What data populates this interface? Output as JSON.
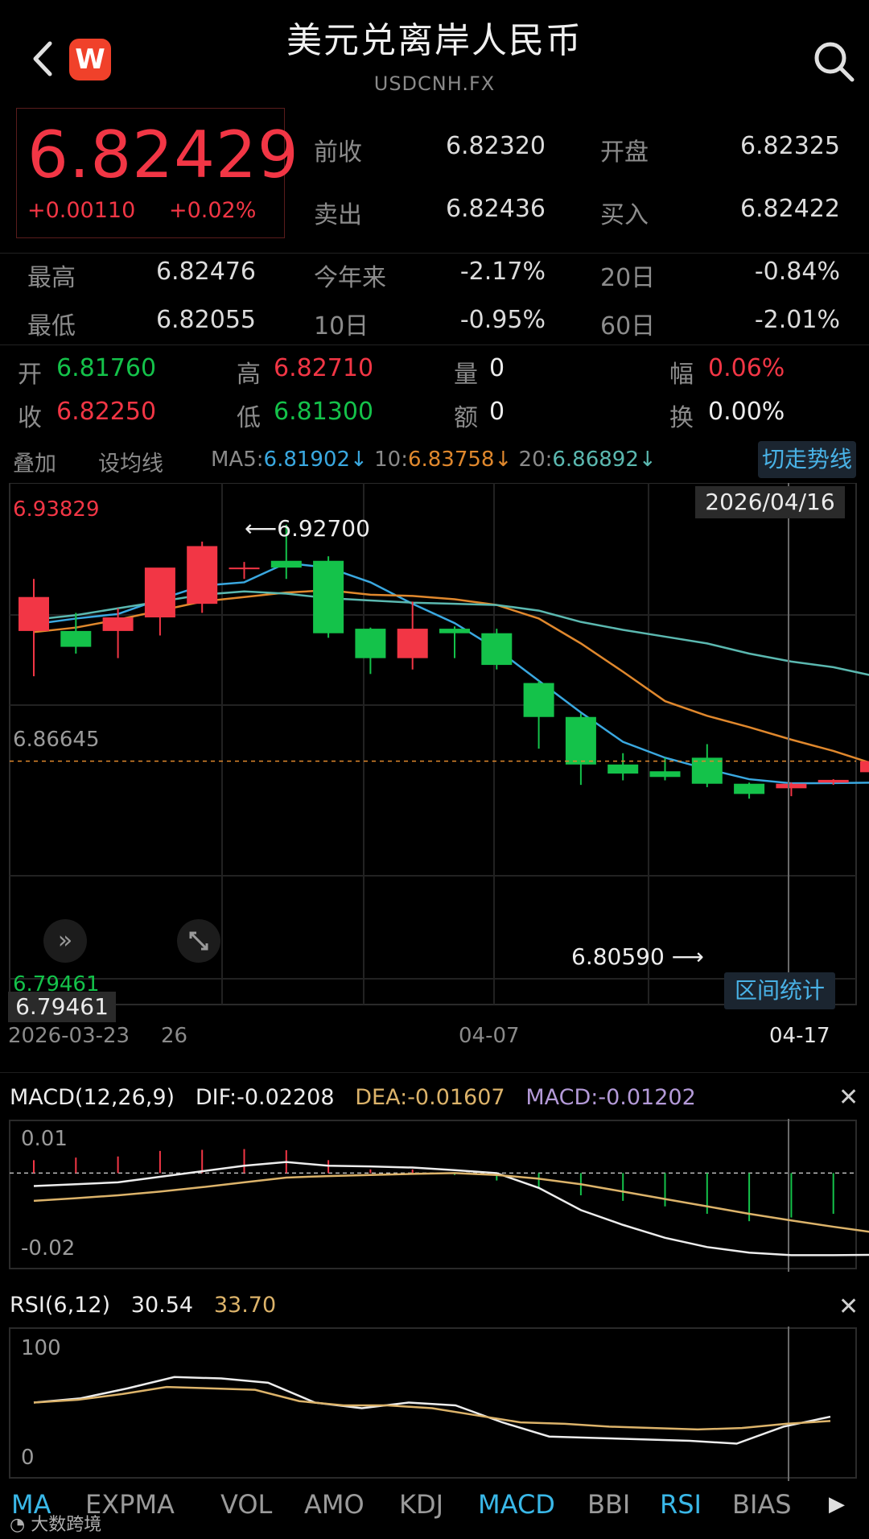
{
  "header": {
    "title": "美元兑离岸人民币",
    "symbol": "USDCNH.FX",
    "logo_letter": "W"
  },
  "quote": {
    "price": "6.82429",
    "change": "+0.00110",
    "change_pct": "+0.02%",
    "prev_close_label": "前收",
    "prev_close": "6.82320",
    "open_label": "开盘",
    "open": "6.82325",
    "ask_label": "卖出",
    "ask": "6.82436",
    "bid_label": "买入",
    "bid": "6.82422"
  },
  "stats": {
    "high_label": "最高",
    "high": "6.82476",
    "ytd_label": "今年来",
    "ytd": "-2.17%",
    "d20_label": "20日",
    "d20": "-0.84%",
    "low_label": "最低",
    "low": "6.82055",
    "d10_label": "10日",
    "d10": "-0.95%",
    "d60_label": "60日",
    "d60": "-2.01%"
  },
  "ohlc": {
    "open_label": "开",
    "open": "6.81760",
    "high_label": "高",
    "high": "6.82710",
    "vol_label": "量",
    "vol": "0",
    "amp_label": "幅",
    "amp": "0.06%",
    "close_label": "收",
    "close": "6.82250",
    "low_label": "低",
    "low": "6.81300",
    "amt_label": "额",
    "amt": "0",
    "turn_label": "换",
    "turn": "0.00%"
  },
  "toolbar": {
    "overlay": "叠加",
    "set_ma": "设均线",
    "ma5_label": "MA5:",
    "ma5": "6.81902↓",
    "ma10_label": "10:",
    "ma10": "6.83758↓",
    "ma20_label": "20:",
    "ma20": "6.86892↓",
    "switch_trend": "切走势线"
  },
  "main_chart": {
    "top_price": "6.93829",
    "mid_price": "6.86645",
    "bottom_price": "6.79461",
    "crosshair_price": "6.79461",
    "crosshair_date": "2026/04/16",
    "max_annot": "6.92700",
    "min_annot": "6.80590",
    "date_start": "2026-03-23",
    "date_26": "26",
    "date_mid": "04-07",
    "date_end": "04-17",
    "range_stats": "区间统计"
  },
  "chart_data": [
    {
      "type": "candlestick",
      "ylim": [
        6.79461,
        6.93829
      ],
      "candles": [
        {
          "o": 6.88,
          "h": 6.903,
          "l": 6.86,
          "c": 6.895
        },
        {
          "o": 6.88,
          "h": 6.888,
          "l": 6.87,
          "c": 6.873
        },
        {
          "o": 6.88,
          "h": 6.89,
          "l": 6.868,
          "c": 6.886
        },
        {
          "o": 6.886,
          "h": 6.905,
          "l": 6.878,
          "c": 6.908
        },
        {
          "o": 6.892,
          "h": 6.9195,
          "l": 6.888,
          "c": 6.9175
        },
        {
          "o": 6.908,
          "h": 6.9105,
          "l": 6.903,
          "c": 6.908
        },
        {
          "o": 6.911,
          "h": 6.927,
          "l": 6.903,
          "c": 6.908
        },
        {
          "o": 6.911,
          "h": 6.913,
          "l": 6.877,
          "c": 6.879
        },
        {
          "o": 6.881,
          "h": 6.8815,
          "l": 6.861,
          "c": 6.868
        },
        {
          "o": 6.868,
          "h": 6.893,
          "l": 6.863,
          "c": 6.881
        },
        {
          "o": 6.881,
          "h": 6.882,
          "l": 6.868,
          "c": 6.879
        },
        {
          "o": 6.879,
          "h": 6.881,
          "l": 6.863,
          "c": 6.865
        },
        {
          "o": 6.857,
          "h": 6.858,
          "l": 6.828,
          "c": 6.842
        },
        {
          "o": 6.842,
          "h": 6.8435,
          "l": 6.812,
          "c": 6.821
        },
        {
          "o": 6.821,
          "h": 6.826,
          "l": 6.814,
          "c": 6.817
        },
        {
          "o": 6.818,
          "h": 6.824,
          "l": 6.814,
          "c": 6.8155
        },
        {
          "o": 6.824,
          "h": 6.83,
          "l": 6.811,
          "c": 6.8125
        },
        {
          "o": 6.8125,
          "h": 6.813,
          "l": 6.8059,
          "c": 6.808
        },
        {
          "o": 6.8105,
          "h": 6.813,
          "l": 6.807,
          "c": 6.8125
        },
        {
          "o": 6.813,
          "h": 6.8145,
          "l": 6.812,
          "c": 6.8142
        },
        {
          "o": 6.8176,
          "h": 6.8271,
          "l": 6.813,
          "c": 6.8225
        }
      ],
      "series": [
        {
          "name": "MA5",
          "values": [
            6.883,
            6.8855,
            6.8875,
            6.894,
            6.9,
            6.9015,
            6.91,
            6.908,
            6.9015,
            6.892,
            6.8835,
            6.872,
            6.858,
            6.844,
            6.831,
            6.824,
            6.819,
            6.8145,
            6.8127,
            6.8128,
            6.813
          ]
        },
        {
          "name": "10",
          "values": [
            6.8795,
            6.8815,
            6.885,
            6.889,
            6.893,
            6.895,
            6.897,
            6.898,
            6.896,
            6.8955,
            6.894,
            6.8915,
            6.8855,
            6.8745,
            6.862,
            6.849,
            6.8425,
            6.8375,
            6.832,
            6.827,
            6.821
          ]
        },
        {
          "name": "20",
          "values": [
            6.885,
            6.887,
            6.89,
            6.893,
            6.896,
            6.8975,
            6.8965,
            6.8945,
            6.8935,
            6.8925,
            6.892,
            6.8915,
            6.889,
            6.884,
            6.8805,
            6.8775,
            6.8745,
            6.87,
            6.8665,
            6.864,
            6.86
          ]
        }
      ]
    },
    {
      "type": "bar",
      "title": "MACD(12,26,9)",
      "ylabel_top": "0.01",
      "ylabel_bottom": "-0.02",
      "ylim": [
        -0.0245,
        0.0125
      ],
      "values": [
        0.0035,
        0.0042,
        0.0045,
        0.006,
        0.0063,
        0.0065,
        0.0062,
        0.0035,
        0.001,
        0.001,
        -0.0005,
        -0.002,
        -0.004,
        -0.006,
        -0.0075,
        -0.009,
        -0.011,
        -0.013,
        -0.012,
        -0.011,
        -0.006
      ],
      "series": [
        {
          "name": "DIF",
          "values": [
            -0.0035,
            -0.003,
            -0.0025,
            -0.001,
            0.0005,
            0.002,
            0.003,
            0.002,
            0.0018,
            0.0015,
            0.0008,
            0.0,
            -0.004,
            -0.01,
            -0.014,
            -0.0175,
            -0.02,
            -0.0215,
            -0.0222,
            -0.0222,
            -0.0221
          ]
        },
        {
          "name": "DEA",
          "values": [
            -0.0075,
            -0.0068,
            -0.006,
            -0.005,
            -0.0038,
            -0.0025,
            -0.0012,
            -0.0008,
            -0.0005,
            -0.0002,
            0.0,
            -0.0005,
            -0.0015,
            -0.003,
            -0.005,
            -0.007,
            -0.009,
            -0.011,
            -0.0128,
            -0.0145,
            -0.0161
          ]
        }
      ]
    },
    {
      "type": "line",
      "title": "RSI(6,12)",
      "ylabel_top": "100",
      "ylabel_bottom": "0",
      "ylim": [
        0,
        100
      ],
      "series": [
        {
          "name": "RSI6",
          "values": [
            52,
            55,
            62,
            70,
            69,
            66,
            52,
            48,
            52,
            50,
            38,
            28,
            27,
            26,
            25,
            23,
            35,
            42
          ]
        },
        {
          "name": "RSI12",
          "values": [
            52,
            54,
            58,
            63,
            62,
            61,
            53,
            50,
            50,
            48,
            43,
            38,
            37,
            35,
            34,
            33,
            34,
            37,
            39
          ]
        }
      ]
    }
  ],
  "macd": {
    "title": "MACD(12,26,9)",
    "dif": "DIF:-0.02208",
    "dea": "DEA:-0.01607",
    "macd": "MACD:-0.01202",
    "y_top": "0.01",
    "y_bottom": "-0.02"
  },
  "rsi": {
    "title": "RSI(6,12)",
    "v6": "30.54",
    "v12": "33.70",
    "y_top": "100",
    "y_bottom": "0"
  },
  "tabs": [
    "MA",
    "EXPMA",
    "VOL",
    "AMO",
    "KDJ",
    "MACD",
    "BBI",
    "RSI",
    "BIAS"
  ],
  "watermark": "大数跨境",
  "colors": {
    "up": "#f23645",
    "down": "#14c24a",
    "ma5": "#3aa8e0",
    "ma10": "#e0882d",
    "ma20": "#5bb8b0",
    "accent": "#3ab8e8"
  }
}
